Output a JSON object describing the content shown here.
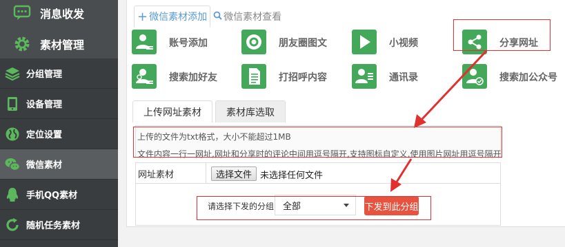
{
  "sidebar": {
    "top_items": [
      {
        "label": "消息收发",
        "icon": "chat-icon"
      },
      {
        "label": "素材管理",
        "icon": "gear-icon"
      }
    ],
    "items": [
      {
        "label": "分组管理",
        "icon": "layers-icon"
      },
      {
        "label": "设备管理",
        "icon": "phone-icon"
      },
      {
        "label": "定位设置",
        "icon": "globe-icon"
      },
      {
        "label": "微信素材",
        "icon": "wechat-icon",
        "active": true
      },
      {
        "label": "手机QQ素材",
        "icon": "qq-icon"
      },
      {
        "label": "随机任务素材",
        "icon": "refresh-icon"
      }
    ]
  },
  "tabs": {
    "add": "微信素材添加",
    "view": "微信素材查看"
  },
  "grid": [
    {
      "label": "账号添加",
      "icon": "user-add-icon"
    },
    {
      "label": "朋友圈图文",
      "icon": "camera-icon"
    },
    {
      "label": "小视频",
      "icon": "play-icon"
    },
    {
      "label": "分享网址",
      "icon": "share-icon"
    },
    {
      "label": "搜索加好友",
      "icon": "search-friend-icon"
    },
    {
      "label": "打招呼内容",
      "icon": "document-icon"
    },
    {
      "label": "通讯录",
      "icon": "contacts-icon"
    },
    {
      "label": "搜索加公众号",
      "icon": "official-account-icon"
    }
  ],
  "subtabs": {
    "upload": "上传网址素材",
    "library": "素材库选取"
  },
  "info": {
    "line1": "上传的文件为txt格式，大小不能超过1MB",
    "line2": "文件内容一行一网址,网址和分享时的评论中间用逗号隔开,支持图标自定义,使用图片网址用逗号隔开"
  },
  "form": {
    "file_label": "网址素材",
    "file_button": "选择文件",
    "file_status": "未选择任何文件",
    "group_label": "请选择下发的分组",
    "group_value": "全部",
    "send_button": "下发到此分组"
  },
  "colors": {
    "accent_green": "#43a85a",
    "highlight_red": "#e03030",
    "send_button": "#e8533f",
    "link_blue": "#5b9bd5"
  }
}
